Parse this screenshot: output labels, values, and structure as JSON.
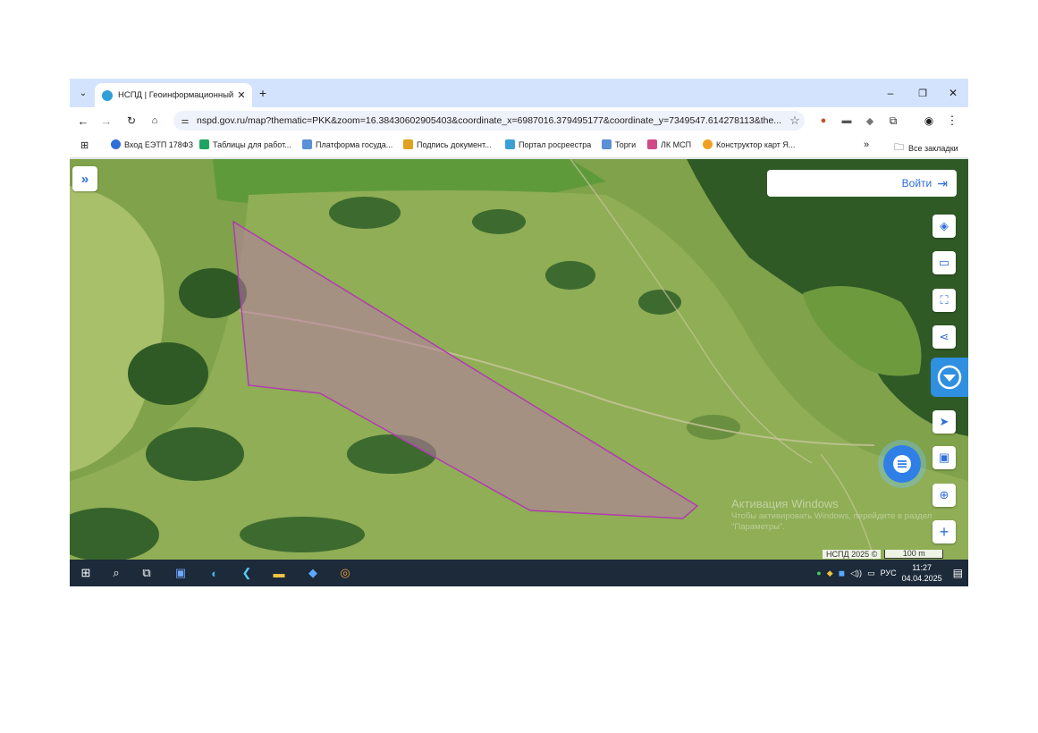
{
  "browser": {
    "tab_title": "НСПД | Геоинформационный",
    "url": "nspd.gov.ru/map?thematic=PKK&zoom=16.38430602905403&coordinate_x=6987016.379495177&coordinate_y=7349547.614278113&the..."
  },
  "bookmarks": [
    {
      "label": "Вход ЕЭТП 178ФЗ",
      "color": "#2f6fd8"
    },
    {
      "label": "Таблицы для работ...",
      "color": "#1ea362"
    },
    {
      "label": "Платформа госуда...",
      "color": "#5b8fd6"
    },
    {
      "label": "Подпись документ...",
      "color": "#e0a020"
    },
    {
      "label": "Портал росреестра",
      "color": "#3aa0d8"
    },
    {
      "label": "Торги",
      "color": "#5b8fd6"
    },
    {
      "label": "ЛК МСП",
      "color": "#d04a8a"
    },
    {
      "label": "Конструктор карт Я...",
      "color": "#f0a020"
    }
  ],
  "bookmarks_overflow": "»",
  "all_bookmarks": "Все закладки",
  "map": {
    "login_label": "Войти",
    "watermark_title": "Активация Windows",
    "watermark_text": "Чтобы активировать Windows, перейдите в раздел \"Параметры\".",
    "copyright": "НСПД 2025 ©",
    "scale_label": "100 m",
    "accent_color": "#2f6fd8",
    "parcel_color": "#b23bb0"
  },
  "taskbar": {
    "lang": "РУС",
    "time": "11:27",
    "date": "04.04.2025"
  }
}
